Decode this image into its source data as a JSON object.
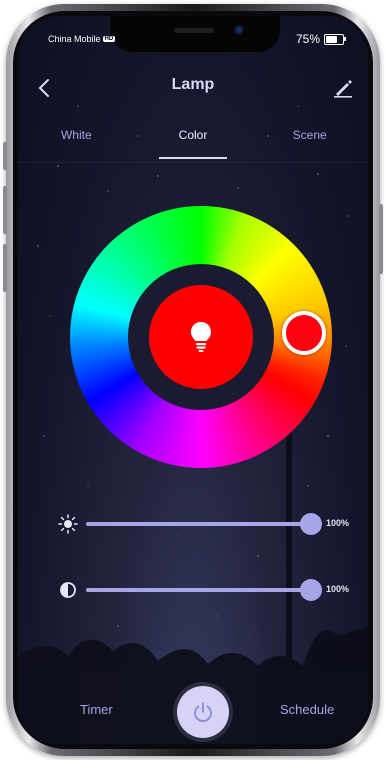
{
  "status_bar": {
    "carrier": "China Mobile",
    "carrier_badge": "HD",
    "battery_text": "75%",
    "battery_level": 0.75
  },
  "header": {
    "title": "Lamp",
    "back_icon": "chevron-left-icon",
    "edit_icon": "pencil-icon"
  },
  "tabs": [
    {
      "label": "White",
      "active": false
    },
    {
      "label": "Color",
      "active": true
    },
    {
      "label": "Scene",
      "active": false
    }
  ],
  "color_picker": {
    "selected_color": "#ff0000",
    "center_icon": "lightbulb-icon"
  },
  "sliders": {
    "brightness": {
      "icon": "sun-icon",
      "value": 1.0,
      "value_text": "100%"
    },
    "saturation": {
      "icon": "contrast-icon",
      "value": 1.0,
      "value_text": "100%"
    }
  },
  "bottom_bar": {
    "timer_label": "Timer",
    "schedule_label": "Schedule",
    "power_icon": "power-icon"
  },
  "colors": {
    "accent": "#a8a5e6",
    "power_button": "#d6d3f7",
    "background": "#1a1b30"
  }
}
